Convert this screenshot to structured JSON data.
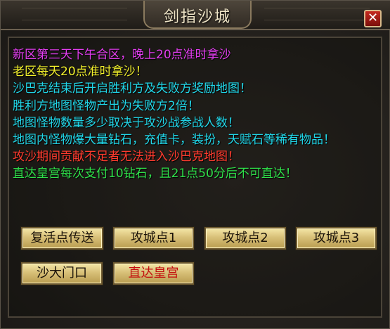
{
  "window": {
    "title": "剑指沙城",
    "close_icon": "close-icon"
  },
  "colors": {
    "magenta": "#e23df0",
    "yellow": "#f2f02c",
    "cyan": "#21d6e8",
    "red": "#ff3b2e",
    "green": "#2fe04a"
  },
  "messages": [
    {
      "text": "新区第三天下午合区，晚上20点准时拿沙",
      "color": "#e23df0"
    },
    {
      "text": "老区每天20点准时拿沙！",
      "color": "#f2f02c"
    },
    {
      "text": "沙巴克结束后开启胜利方及失败方奖励地图！",
      "color": "#21d6e8"
    },
    {
      "text": "胜利方地图怪物产出为失败方2倍！",
      "color": "#21d6e8"
    },
    {
      "text": "地图怪物数量多少取决于攻沙战参战人数！",
      "color": "#21d6e8"
    },
    {
      "text": "地图内怪物爆大量钻石，充值卡，装扮，天赋石等稀有物品！",
      "color": "#21d6e8"
    },
    {
      "text": "攻沙期间贡献不足者无法进入沙巴克地图！",
      "color": "#ff3b2e"
    },
    {
      "text": "直达皇宫每次支付10钻石，且21点50分后不可直达！",
      "color": "#2fe04a"
    }
  ],
  "buttons": {
    "revive": "复活点传送",
    "siege1": "攻城点1",
    "siege2": "攻城点2",
    "siege3": "攻城点3",
    "gate": "沙大门口",
    "palace": "直达皇宫"
  }
}
